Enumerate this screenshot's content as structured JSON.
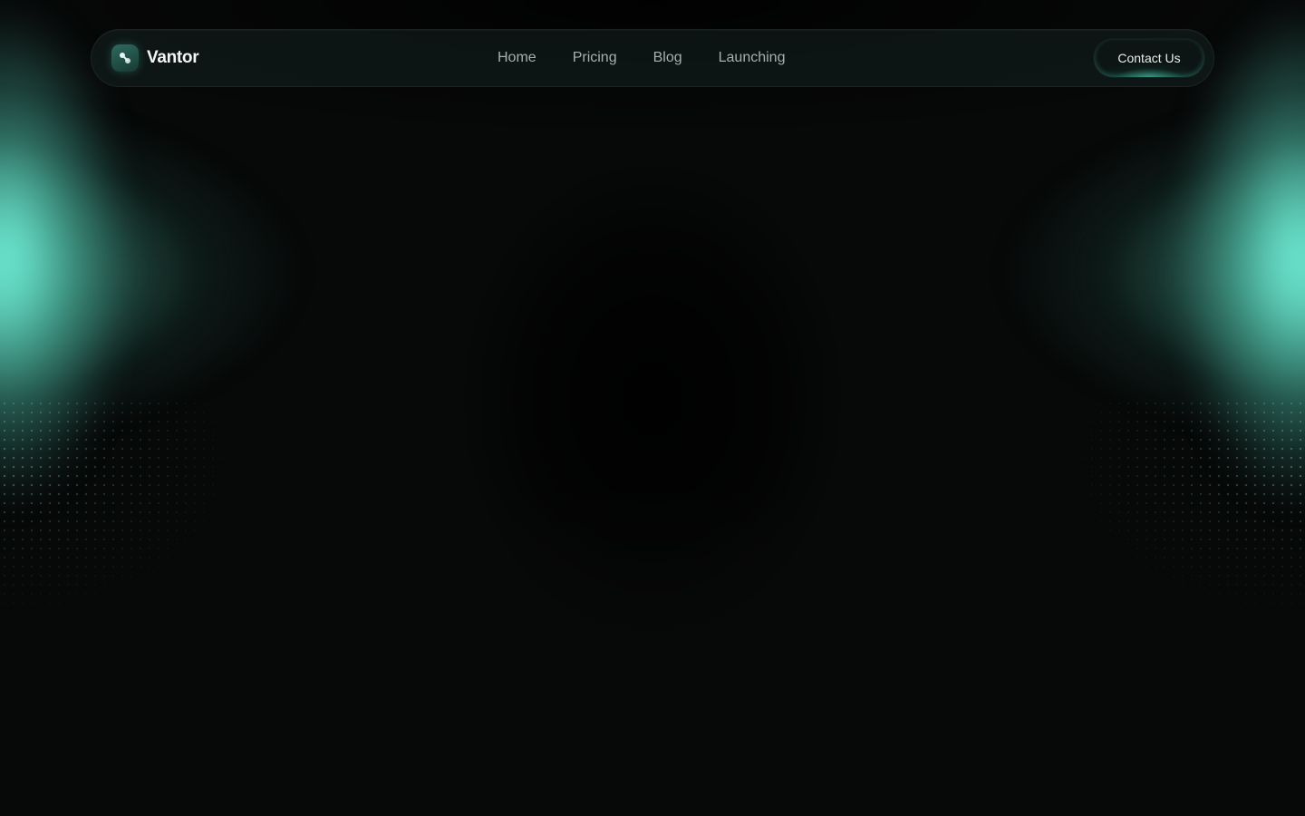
{
  "brand": {
    "name": "Vantor",
    "logo_icon": "nodes-icon"
  },
  "nav": {
    "items": [
      {
        "label": "Home"
      },
      {
        "label": "Pricing"
      },
      {
        "label": "Blog"
      },
      {
        "label": "Launching"
      }
    ]
  },
  "cta": {
    "label": "Contact Us"
  },
  "theme": {
    "accent": "#6ef0d2",
    "background": "#070808"
  }
}
